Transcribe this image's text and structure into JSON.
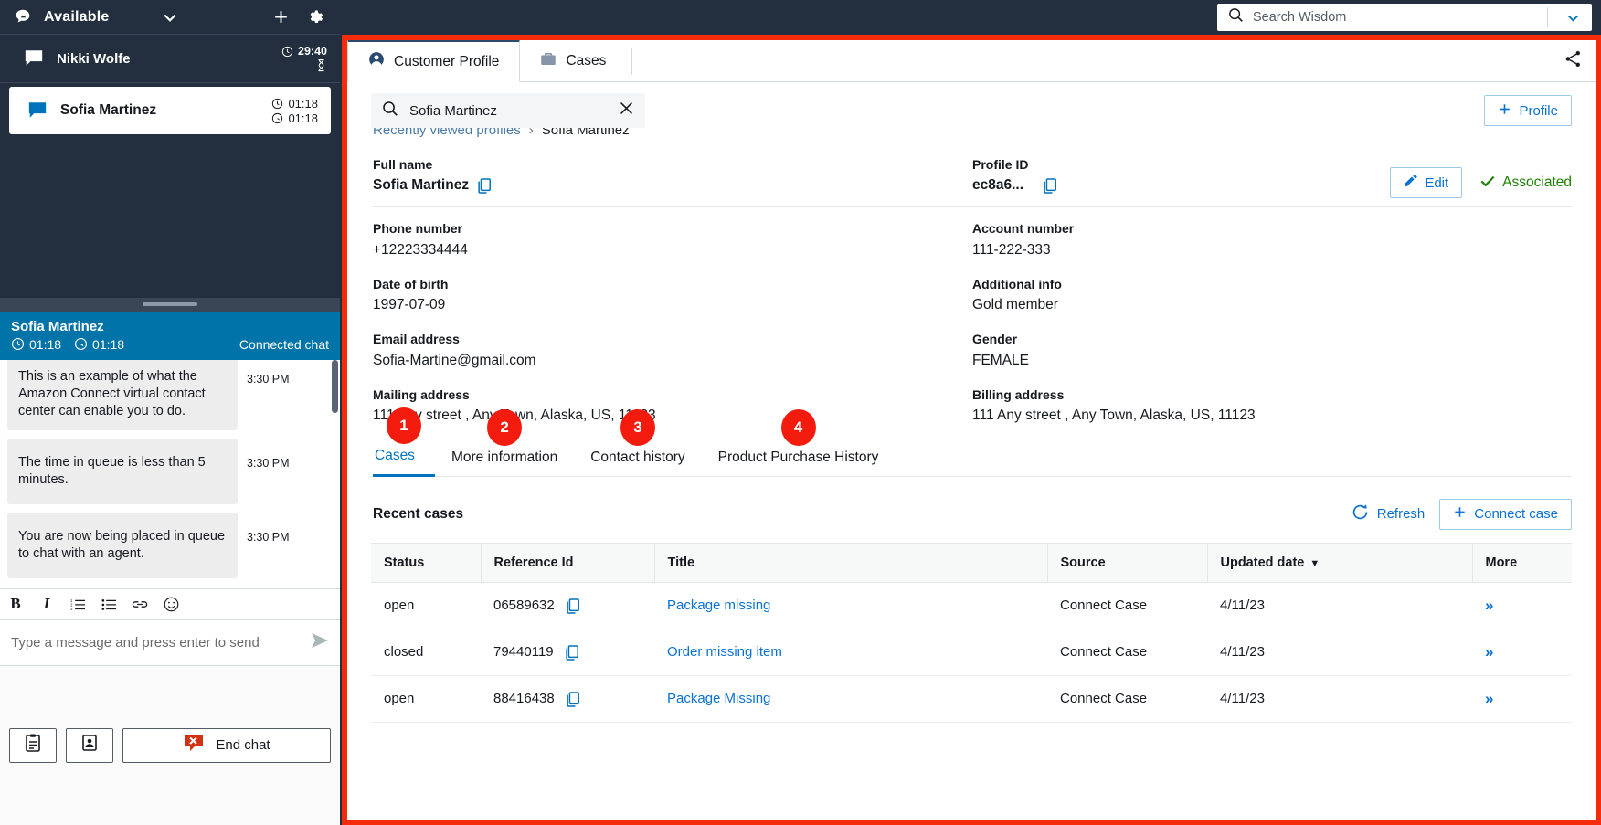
{
  "ccp": {
    "status": "Available",
    "icons": {
      "logo": "amazon-connect-logo",
      "caret": "chevron-down-icon",
      "plus": "plus-icon",
      "gear": "gear-icon"
    },
    "contacts": [
      {
        "name": "Nikki Wolfe",
        "icon": "chat-bubble-icon",
        "timer1": "29:40",
        "timer2": "",
        "selected": false
      },
      {
        "name": "Sofia Martinez",
        "icon": "chat-bubble-icon",
        "timer1": "01:18",
        "timer2": "01:18",
        "selected": true
      }
    ],
    "chat": {
      "customer": "Sofia Martinez",
      "timer_clock": "01:18",
      "timer_hold": "01:18",
      "state": "Connected chat",
      "messages": [
        {
          "text": "This is an example of what the Amazon Connect virtual contact center can enable you to do.",
          "time": "3:30 PM"
        },
        {
          "text": "The time in queue is less than 5 minutes.",
          "time": "3:30 PM"
        },
        {
          "text": "You are now being placed in queue to chat with an agent.",
          "time": "3:30 PM"
        }
      ]
    },
    "composer": {
      "tools": [
        "B",
        "I",
        "numbered-list-icon",
        "bullet-list-icon",
        "link-icon",
        "emoji-icon"
      ],
      "placeholder": "Type a message and press enter to send",
      "send_icon": "send-icon"
    },
    "actions": {
      "quick_responses_icon": "clipboard-icon",
      "contact_card_icon": "contact-card-icon",
      "end_chat_label": "End chat",
      "end_chat_icon": "end-chat-icon"
    }
  },
  "topbar": {
    "search_placeholder": "Search Wisdom",
    "search_icon": "search-icon",
    "caret_icon": "chevron-down-icon"
  },
  "tabs": [
    {
      "label": "Customer Profile",
      "icon": "user-circle-icon",
      "active": true
    },
    {
      "label": "Cases",
      "icon": "briefcase-icon",
      "active": false
    }
  ],
  "share_icon": "share-icon",
  "profile_search": {
    "value": "Sofia Martinez",
    "search_icon": "search-icon",
    "clear_icon": "close-icon"
  },
  "add_profile_label": "Profile",
  "breadcrumb": {
    "root": "Recently viewed profiles",
    "separator": "›",
    "current": "Sofia Martinez"
  },
  "edit_button_label": "Edit",
  "edit_icon": "pencil-icon",
  "associated_label": "Associated",
  "associated_icon": "check-icon",
  "associated_color": "#1d8102",
  "fields": [
    {
      "label": "Full name",
      "value": "Sofia Martinez",
      "copy": true,
      "strong": true
    },
    {
      "label": "Profile ID",
      "value": "ec8a6...",
      "copy": true,
      "strong": true
    },
    {
      "label": "Phone number",
      "value": "+12223334444",
      "copy": false,
      "strong": false
    },
    {
      "label": "Account number",
      "value": "111-222-333",
      "copy": false,
      "strong": false
    },
    {
      "label": "Date of birth",
      "value": "1997-07-09",
      "copy": false,
      "strong": false
    },
    {
      "label": "Additional info",
      "value": "Gold member",
      "copy": false,
      "strong": false
    },
    {
      "label": "Email address",
      "value": "Sofia-Martine@gmail.com",
      "copy": false,
      "strong": false
    },
    {
      "label": "Gender",
      "value": "FEMALE",
      "copy": false,
      "strong": false
    },
    {
      "label": "Mailing address",
      "value": "111 Any street , Any Town, Alaska, US, 11123",
      "copy": false,
      "strong": false
    },
    {
      "label": "Billing address",
      "value": "111 Any street , Any Town, Alaska, US, 11123",
      "copy": false,
      "strong": false
    }
  ],
  "inner_tabs": [
    {
      "badge": "1",
      "label": "Cases",
      "active": true
    },
    {
      "badge": "2",
      "label": "More information",
      "active": false
    },
    {
      "badge": "3",
      "label": "Contact history",
      "active": false
    },
    {
      "badge": "4",
      "label": "Product Purchase History",
      "active": false
    }
  ],
  "badge_color": "#f21b0d",
  "cases_section": {
    "title": "Recent cases",
    "refresh_label": "Refresh",
    "refresh_icon": "refresh-icon",
    "connect_case_label": "Connect case",
    "columns": [
      "Status",
      "Reference Id",
      "Title",
      "Source",
      "Updated date",
      "More"
    ],
    "sorted_column": "Updated date",
    "sort_icon": "caret-down-icon",
    "rows": [
      {
        "status": "open",
        "reference_id": "06589632",
        "title": "Package missing",
        "source": "Connect Case",
        "updated_date": "4/11/23",
        "more": "»"
      },
      {
        "status": "closed",
        "reference_id": "79440119",
        "title": "Order missing item",
        "source": "Connect Case",
        "updated_date": "4/11/23",
        "more": "»"
      },
      {
        "status": "open",
        "reference_id": "88416438",
        "title": "Package Missing",
        "source": "Connect Case",
        "updated_date": "4/11/23",
        "more": "»"
      }
    ]
  },
  "highlight_color": "#f62b0a"
}
